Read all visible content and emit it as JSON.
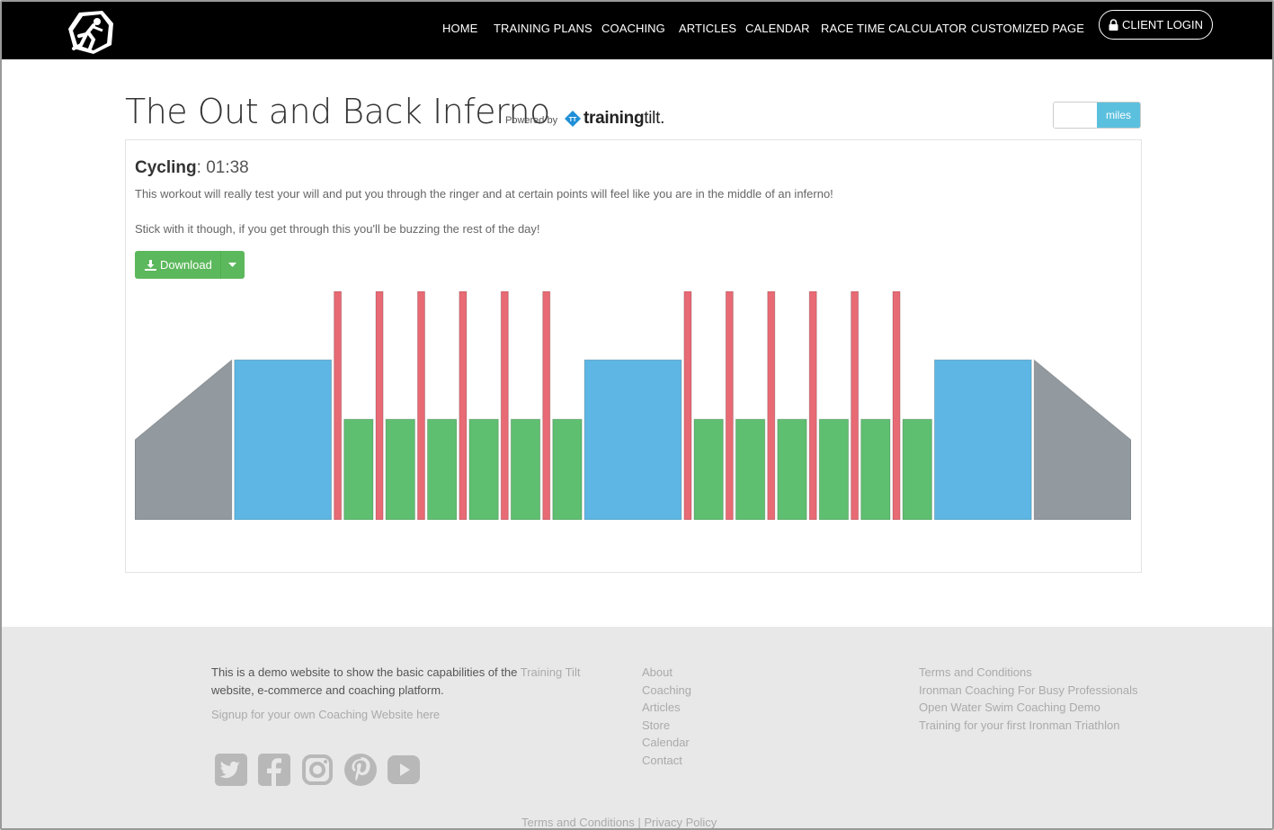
{
  "nav": {
    "items": [
      "HOME",
      "TRAINING PLANS",
      "COACHING",
      "ARTICLES",
      "CALENDAR",
      "RACE TIME CALCULATOR",
      "CUSTOMIZED PAGE"
    ],
    "login_label": "CLIENT LOGIN"
  },
  "page": {
    "title": "The Out and Back Inferno",
    "powered_by": "Powered by",
    "brand_name": "training",
    "brand_suffix": "tilt.",
    "unit_label": "miles"
  },
  "workout": {
    "sport": "Cycling",
    "separator": ":",
    "duration": "01:38",
    "description_1": "This workout will really test your will and put you through the ringer and at certain points will feel like you are in the middle of an inferno!",
    "description_2": "Stick with it though, if you get through this you'll be buzzing the rest of the day!",
    "download_label": "Download"
  },
  "chart_data": {
    "type": "bar",
    "title": "",
    "xlabel": "",
    "ylabel": "",
    "colors": {
      "warmup": "#929aa0",
      "tempo": "#5db6e3",
      "interval": "#e86a74",
      "recovery": "#5ebf70"
    },
    "segments": [
      {
        "zone": "warmup",
        "duration": 10,
        "start_intensity": 0.35,
        "end_intensity": 0.7
      },
      {
        "zone": "tempo",
        "duration": 10,
        "intensity": 0.7
      },
      {
        "zone": "interval",
        "duration": 0.75,
        "intensity": 1.0
      },
      {
        "zone": "recovery",
        "duration": 3,
        "intensity": 0.44
      },
      {
        "zone": "interval",
        "duration": 0.75,
        "intensity": 1.0
      },
      {
        "zone": "recovery",
        "duration": 3,
        "intensity": 0.44
      },
      {
        "zone": "interval",
        "duration": 0.75,
        "intensity": 1.0
      },
      {
        "zone": "recovery",
        "duration": 3,
        "intensity": 0.44
      },
      {
        "zone": "interval",
        "duration": 0.75,
        "intensity": 1.0
      },
      {
        "zone": "recovery",
        "duration": 3,
        "intensity": 0.44
      },
      {
        "zone": "interval",
        "duration": 0.75,
        "intensity": 1.0
      },
      {
        "zone": "recovery",
        "duration": 3,
        "intensity": 0.44
      },
      {
        "zone": "interval",
        "duration": 0.75,
        "intensity": 1.0
      },
      {
        "zone": "recovery",
        "duration": 3,
        "intensity": 0.44
      },
      {
        "zone": "tempo",
        "duration": 10,
        "intensity": 0.7
      },
      {
        "zone": "interval",
        "duration": 0.75,
        "intensity": 1.0
      },
      {
        "zone": "recovery",
        "duration": 3,
        "intensity": 0.44
      },
      {
        "zone": "interval",
        "duration": 0.75,
        "intensity": 1.0
      },
      {
        "zone": "recovery",
        "duration": 3,
        "intensity": 0.44
      },
      {
        "zone": "interval",
        "duration": 0.75,
        "intensity": 1.0
      },
      {
        "zone": "recovery",
        "duration": 3,
        "intensity": 0.44
      },
      {
        "zone": "interval",
        "duration": 0.75,
        "intensity": 1.0
      },
      {
        "zone": "recovery",
        "duration": 3,
        "intensity": 0.44
      },
      {
        "zone": "interval",
        "duration": 0.75,
        "intensity": 1.0
      },
      {
        "zone": "recovery",
        "duration": 3,
        "intensity": 0.44
      },
      {
        "zone": "interval",
        "duration": 0.75,
        "intensity": 1.0
      },
      {
        "zone": "recovery",
        "duration": 3,
        "intensity": 0.44
      },
      {
        "zone": "tempo",
        "duration": 10,
        "intensity": 0.7
      },
      {
        "zone": "warmup",
        "duration": 10,
        "start_intensity": 0.7,
        "end_intensity": 0.35
      }
    ]
  },
  "footer": {
    "about_text": "This is a demo website to show the basic capabilities of the",
    "about_link": "Training Tilt",
    "about_text_2": "website, e-commerce and coaching platform.",
    "signup": "Signup for your own Coaching Website here",
    "links_col_1": [
      "About",
      "Coaching",
      "Articles",
      "Store",
      "Calendar",
      "Contact"
    ],
    "links_col_2": [
      "Terms and Conditions",
      "Ironman Coaching For Busy Professionals",
      "Open Water Swim Coaching Demo",
      "Training for your first Ironman Triathlon"
    ],
    "social_icons": [
      "twitter-icon",
      "facebook-icon",
      "instagram-icon",
      "pinterest-icon",
      "youtube-icon"
    ],
    "bottom_terms": "Terms and Conditions",
    "bottom_sep": "|",
    "bottom_privacy": "Privacy Policy"
  }
}
